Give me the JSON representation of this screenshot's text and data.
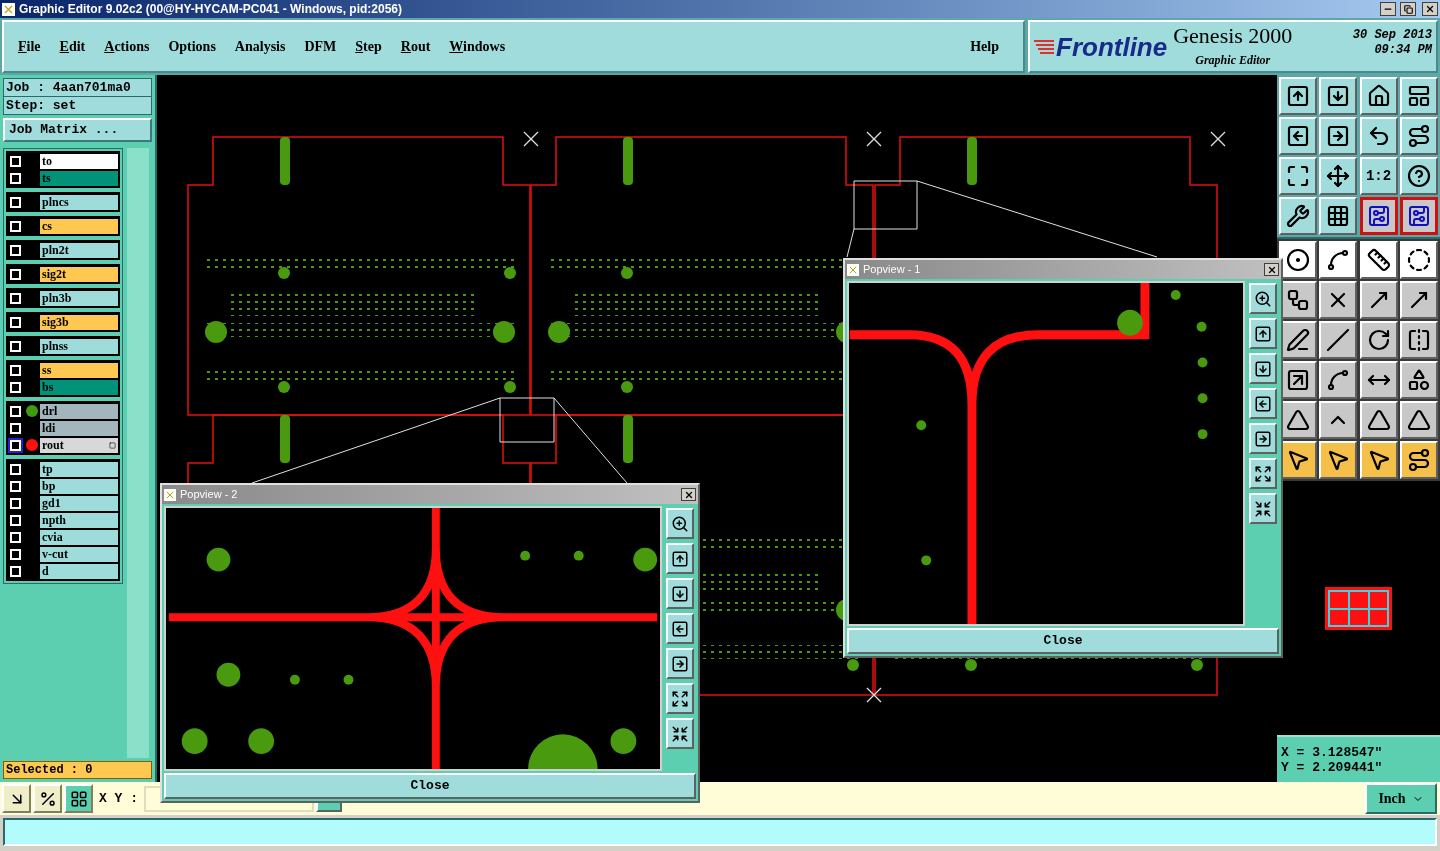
{
  "window": {
    "title": "Graphic Editor 9.02c2 (00@HY-HYCAM-PC041 - Windows, pid:2056)"
  },
  "menu": [
    {
      "label": "File",
      "mnemonic": true
    },
    {
      "label": "Edit",
      "mnemonic": true
    },
    {
      "label": "Actions",
      "mnemonic": true
    },
    {
      "label": "Options",
      "mnemonic": false
    },
    {
      "label": "Analysis",
      "mnemonic": false
    },
    {
      "label": "DFM",
      "mnemonic": false
    },
    {
      "label": "Step",
      "mnemonic": true
    },
    {
      "label": "Rout",
      "mnemonic": true
    },
    {
      "label": "Windows",
      "mnemonic": true
    }
  ],
  "help_menu": "Help",
  "brand": {
    "logo": "Frontline",
    "product": "Genesis 2000",
    "subtitle": "Graphic Editor",
    "date": "30 Sep 2013",
    "time": "09:34 PM"
  },
  "job": {
    "job": "Job : 4aan701ma0",
    "step": "Step: set",
    "matrix_button": "Job Matrix ..."
  },
  "layer_groups": [
    [
      {
        "name": "to",
        "color": "#ffffff",
        "checked": false,
        "selected": false
      },
      {
        "name": "ts",
        "color": "#00937a",
        "checked": false,
        "selected": false
      }
    ],
    [
      {
        "name": "plncs",
        "color": "#9edcdc",
        "checked": false,
        "selected": false
      }
    ],
    [
      {
        "name": "cs",
        "color": "#ffc850",
        "checked": false,
        "selected": false
      }
    ],
    [
      {
        "name": "pln2t",
        "color": "#9edcdc",
        "checked": false,
        "selected": false
      }
    ],
    [
      {
        "name": "sig2t",
        "color": "#ffc850",
        "checked": false,
        "selected": false
      }
    ],
    [
      {
        "name": "pln3b",
        "color": "#9edcdc",
        "checked": false,
        "selected": false
      }
    ],
    [
      {
        "name": "sig3b",
        "color": "#ffc850",
        "checked": false,
        "selected": false
      }
    ],
    [
      {
        "name": "plnss",
        "color": "#9edcdc",
        "checked": false,
        "selected": false
      }
    ],
    [
      {
        "name": "ss",
        "color": "#ffc850",
        "checked": false,
        "selected": false
      },
      {
        "name": "bs",
        "color": "#00937a",
        "checked": false,
        "selected": false
      }
    ],
    [
      {
        "name": "drl",
        "color": "#a3b5bd",
        "checked": false,
        "selected": false,
        "dot": {
          "color": "#3f9a0e"
        }
      },
      {
        "name": "ldi",
        "color": "#a3b5bd",
        "checked": false,
        "selected": false
      },
      {
        "name": "rout",
        "color": "#d8d8d8",
        "checked": false,
        "selected": true,
        "dot": {
          "color": "#ff1010"
        }
      }
    ],
    [
      {
        "name": "tp",
        "color": "#9edcdc",
        "checked": false,
        "selected": false
      },
      {
        "name": "bp",
        "color": "#9edcdc",
        "checked": false,
        "selected": false
      },
      {
        "name": "gd1",
        "color": "#9edcdc",
        "checked": false,
        "selected": false
      },
      {
        "name": "npth",
        "color": "#9edcdc",
        "checked": false,
        "selected": false
      },
      {
        "name": "cvia",
        "color": "#9edcdc",
        "checked": false,
        "selected": false
      },
      {
        "name": "v-cut",
        "color": "#9edcdc",
        "checked": false,
        "selected": false
      },
      {
        "name": "d",
        "color": "#9edcdc",
        "checked": false,
        "selected": false
      }
    ]
  ],
  "selected_count": "Selected : 0",
  "zoom_ratio": "1:2",
  "board_toggles": [
    {
      "on": true
    },
    {
      "on": true
    }
  ],
  "popviews": [
    {
      "title": "Popview - 1",
      "kind": "tee",
      "close": "Close"
    },
    {
      "title": "Popview - 2",
      "kind": "cross",
      "close": "Close"
    }
  ],
  "coords": {
    "x": "X = 3.128547\"",
    "y": "Y = 2.209441\""
  },
  "xy_label": "X Y :",
  "units": "Inch"
}
